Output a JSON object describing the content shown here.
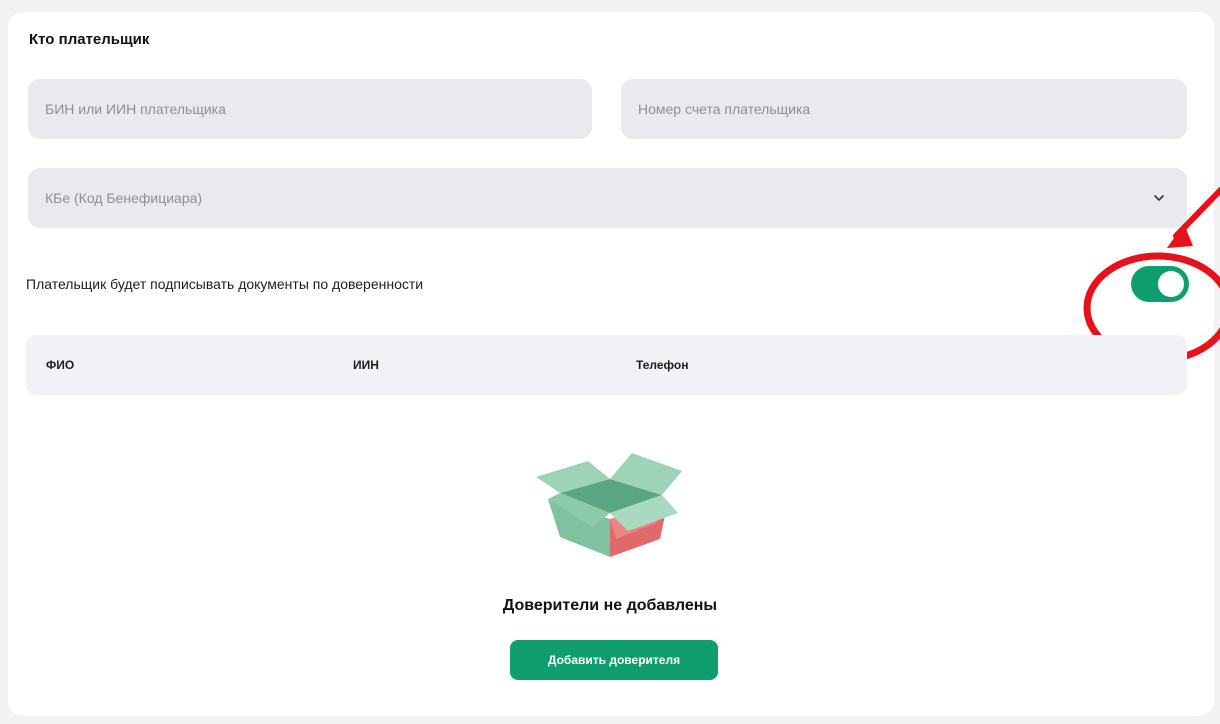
{
  "section": {
    "title": "Кто плательщик"
  },
  "fields": {
    "bin_placeholder": "БИН или ИИН плательщика",
    "account_placeholder": "Номер счета плательщика",
    "kbe_placeholder": "КБе (Код Бенефициара)"
  },
  "proxy_toggle": {
    "label": "Плательщик будет подписывать документы по доверенности",
    "on": true
  },
  "table": {
    "columns": [
      "ФИО",
      "ИИН",
      "Телефон"
    ]
  },
  "empty_state": {
    "message": "Доверители не добавлены",
    "button_label": "Добавить доверителя"
  },
  "colors": {
    "accent": "#0f9f6e",
    "annotation": "#e8101b",
    "field_bg": "#e9eaee"
  },
  "icons": {
    "kbe_dropdown": "chevron-down-icon",
    "empty": "open-box-icon"
  }
}
